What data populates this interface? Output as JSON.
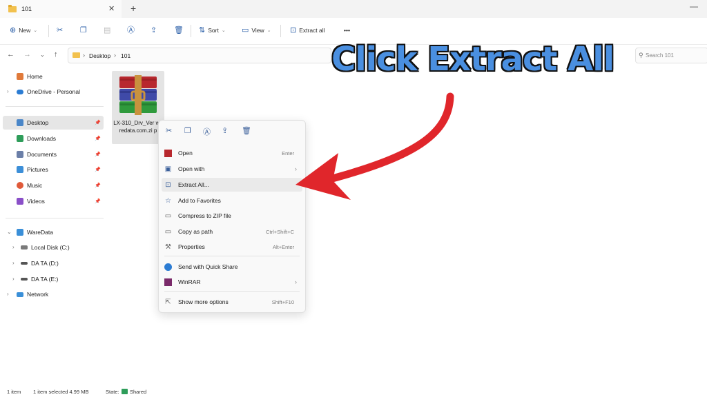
{
  "tab": {
    "title": "101",
    "close": "✕",
    "new": "+"
  },
  "window": {
    "minimize": "—"
  },
  "toolbar": {
    "new_label": "New",
    "sort_label": "Sort",
    "view_label": "View",
    "extract_all_label": "Extract all",
    "more": "•••"
  },
  "address": {
    "crumbs": [
      "Desktop",
      "101"
    ],
    "search_placeholder": "Search 101"
  },
  "sidebar": {
    "items": [
      {
        "label": "Home",
        "color": "#e07a3a"
      },
      {
        "label": "OneDrive - Personal",
        "color": "#2b7cd3"
      },
      {
        "label": "Desktop",
        "color": "#4a86c8"
      },
      {
        "label": "Downloads",
        "color": "#2e9d5a"
      },
      {
        "label": "Documents",
        "color": "#6b7fa8"
      },
      {
        "label": "Pictures",
        "color": "#3c8fd8"
      },
      {
        "label": "Music",
        "color": "#e05a3a"
      },
      {
        "label": "Videos",
        "color": "#8a4fc8"
      },
      {
        "label": "WareData",
        "color": "#3a8fd8"
      },
      {
        "label": "Local Disk (C:)",
        "color": "#7a7a7a"
      },
      {
        "label": "DA TA (D:)",
        "color": "#555555"
      },
      {
        "label": "DA TA (E:)",
        "color": "#555555"
      },
      {
        "label": "Network",
        "color": "#3a8fd8"
      }
    ]
  },
  "file": {
    "name": "LX-310_Drv_Ver waredata.com.zi p"
  },
  "context_menu": {
    "items": [
      {
        "label": "Open",
        "shortcut": "Enter"
      },
      {
        "label": "Open with",
        "shortcut": ""
      },
      {
        "label": "Extract All...",
        "shortcut": ""
      },
      {
        "label": "Add to Favorites",
        "shortcut": ""
      },
      {
        "label": "Compress to ZIP file",
        "shortcut": ""
      },
      {
        "label": "Copy as path",
        "shortcut": "Ctrl+Shift+C"
      },
      {
        "label": "Properties",
        "shortcut": "Alt+Enter"
      },
      {
        "label": "Send with Quick Share",
        "shortcut": ""
      },
      {
        "label": "WinRAR",
        "shortcut": ""
      },
      {
        "label": "Show more options",
        "shortcut": "Shift+F10"
      }
    ]
  },
  "annotation": {
    "text": "Click Extract All",
    "color": "#4a8fe0",
    "arrow_color": "#e0262b"
  },
  "status": {
    "count": "1 item",
    "selected": "1 item selected  4.99 MB",
    "state_label": "State:",
    "state_value": "Shared"
  }
}
